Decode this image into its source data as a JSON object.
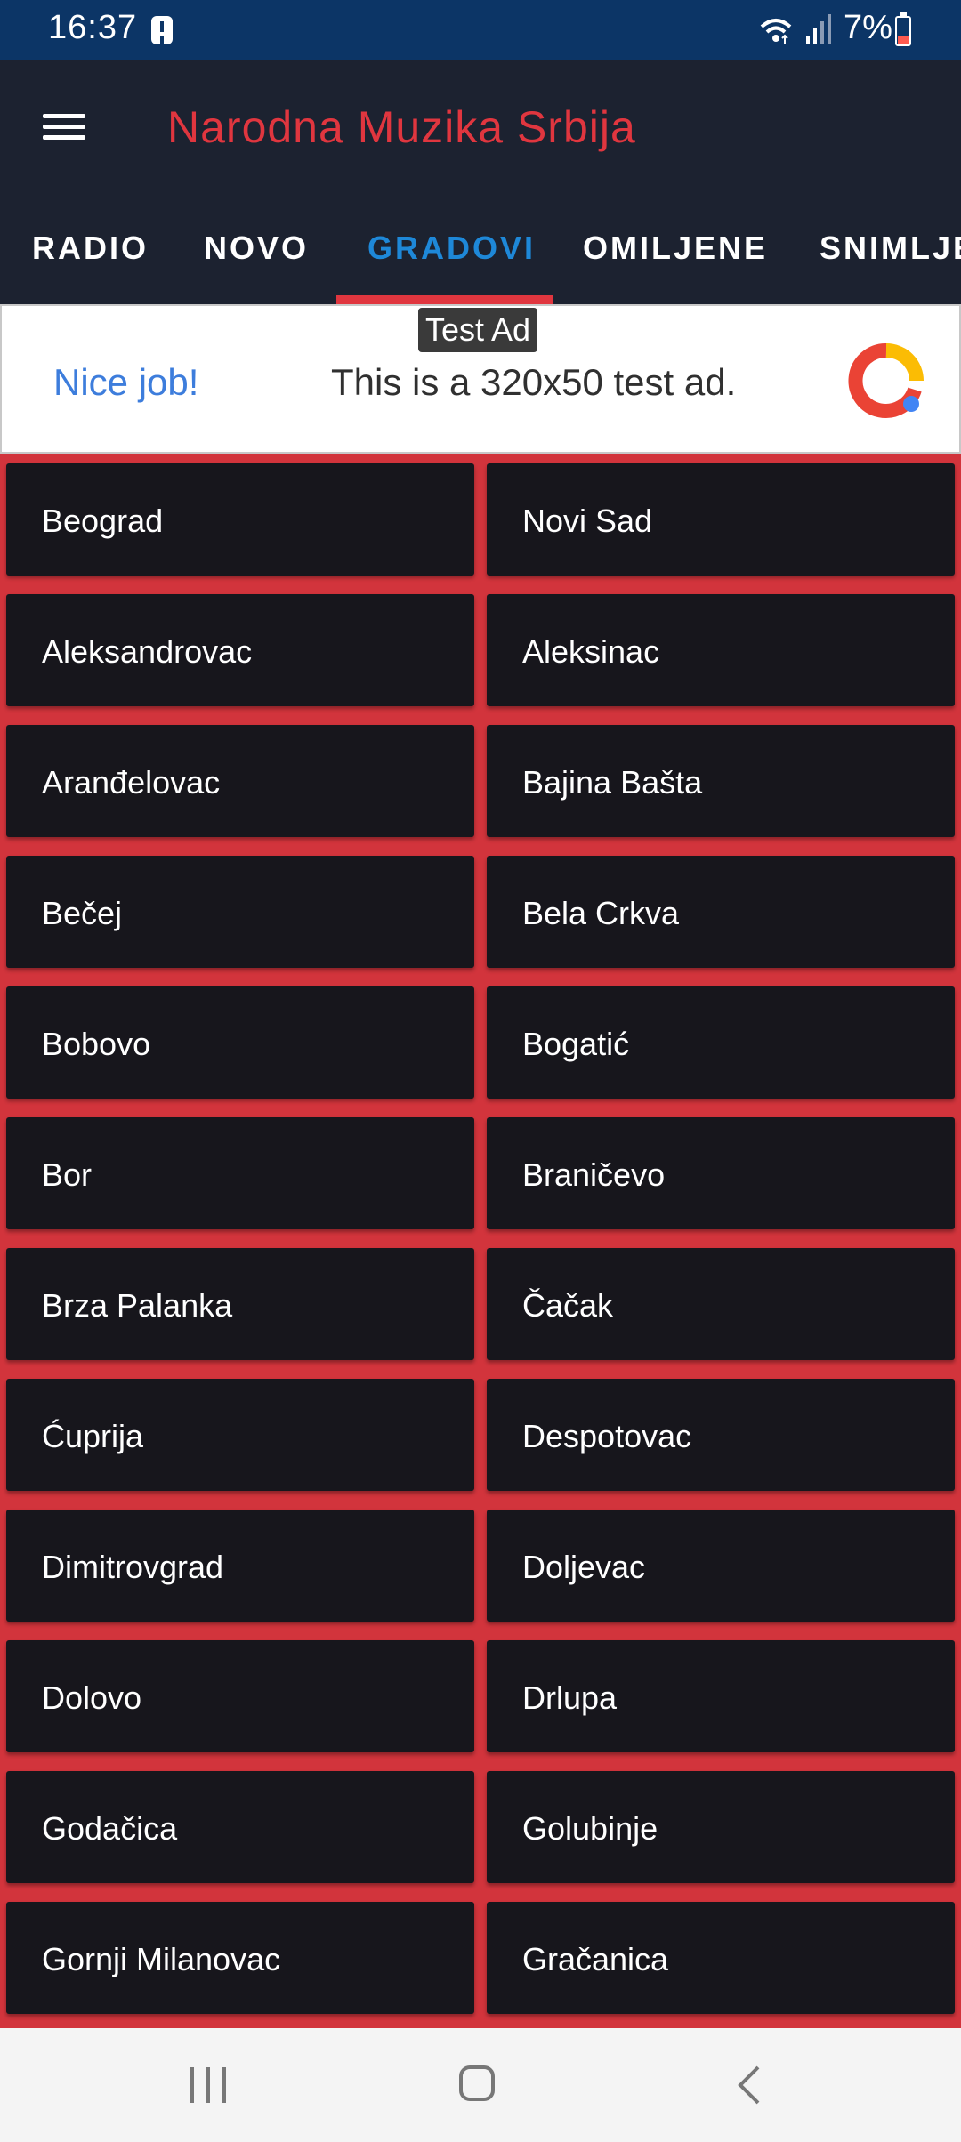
{
  "status_bar": {
    "time": "16:37",
    "battery": "7%",
    "icons": [
      "alert-icon",
      "wifi-icon",
      "signal-icon",
      "battery-icon"
    ]
  },
  "app_bar": {
    "title": "Narodna Muzika Srbija",
    "title_color": "#e0363f",
    "menu_icon": "menu-icon"
  },
  "tabs": [
    {
      "label": "RADIO",
      "active": false
    },
    {
      "label": "NOVO",
      "active": false
    },
    {
      "label": "GRADOVI",
      "active": true
    },
    {
      "label": "OMILJENE",
      "active": false
    },
    {
      "label": "SNIMLJE",
      "active": false
    }
  ],
  "ad": {
    "badge": "Test Ad",
    "nice": "Nice job!",
    "text": "This is a 320x50 test ad.",
    "logo_icon": "ad-logo-icon"
  },
  "cities": [
    "Beograd",
    "Novi Sad",
    "Aleksandrovac",
    "Aleksinac",
    "Aranđelovac",
    "Bajina Bašta",
    "Bečej",
    "Bela Crkva",
    "Bobovo",
    "Bogatić",
    "Bor",
    "Braničevo",
    "Brza Palanka",
    "Čačak",
    "Ćuprija",
    "Despotovac",
    "Dimitrovgrad",
    "Doljevac",
    "Dolovo",
    "Drlupa",
    "Godačica",
    "Golubinje",
    "Gornji Milanovac",
    "Gračanica"
  ],
  "colors": {
    "accent": "#e0363f",
    "active_tab": "#1e88d8",
    "app_bar": "#1c2230",
    "status_bar": "#0c3566",
    "tile": "#17161c",
    "background": "#d2343c"
  },
  "nav_bar": {
    "icons": [
      "recent-apps-icon",
      "home-icon",
      "back-icon"
    ]
  }
}
